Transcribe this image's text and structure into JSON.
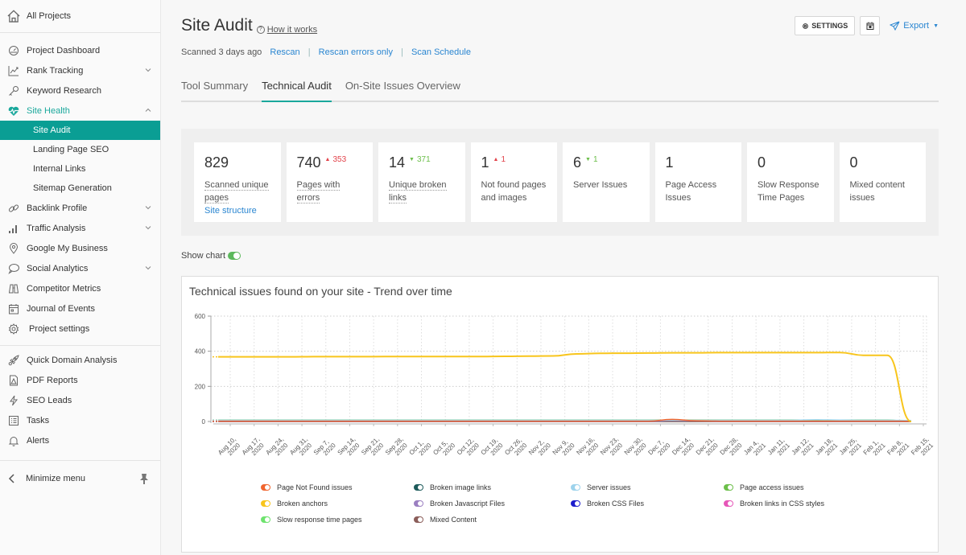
{
  "sidebar": {
    "all_projects": "All Projects",
    "items": [
      {
        "label": "Project Dashboard",
        "icon": "gauge-icon",
        "chevron": null
      },
      {
        "label": "Rank Tracking",
        "icon": "chart-line-icon",
        "chevron": "down"
      },
      {
        "label": "Keyword Research",
        "icon": "key-icon",
        "chevron": null
      },
      {
        "label": "Site Health",
        "icon": "heart-pulse-icon",
        "chevron": "up"
      }
    ],
    "site_health_sub": [
      "Site Audit",
      "Landing Page SEO",
      "Internal Links",
      "Sitemap Generation"
    ],
    "items_after": [
      {
        "label": "Backlink Profile",
        "icon": "link-icon",
        "chevron": "down"
      },
      {
        "label": "Traffic Analysis",
        "icon": "bar-chart-icon",
        "chevron": "down"
      },
      {
        "label": "Google My Business",
        "icon": "map-pin-icon",
        "chevron": null
      },
      {
        "label": "Social Analytics",
        "icon": "speech-bubble-icon",
        "chevron": "down"
      },
      {
        "label": "Competitor Metrics",
        "icon": "binoculars-icon",
        "chevron": null
      },
      {
        "label": "Journal of Events",
        "icon": "calendar-icon",
        "chevron": null
      },
      {
        "label": "Project settings",
        "icon": "gear-icon",
        "chevron": null
      }
    ],
    "tools": [
      {
        "label": "Quick Domain Analysis",
        "icon": "rocket-icon"
      },
      {
        "label": "PDF Reports",
        "icon": "pdf-icon"
      },
      {
        "label": "SEO Leads",
        "icon": "lightning-icon"
      },
      {
        "label": "Tasks",
        "icon": "list-icon"
      },
      {
        "label": "Alerts",
        "icon": "bell-icon"
      }
    ],
    "minimize": "Minimize menu"
  },
  "header": {
    "title": "Site Audit",
    "how_it_works": "How it works",
    "scanned": "Scanned 3 days ago",
    "rescan": "Rescan",
    "rescan_errors": "Rescan errors only",
    "scan_schedule": "Scan Schedule",
    "settings_label": "SETTINGS",
    "export_label": "Export"
  },
  "tabs": [
    {
      "label": "Tool Summary",
      "active": false
    },
    {
      "label": "Technical Audit",
      "active": true
    },
    {
      "label": "On-Site Issues Overview",
      "active": false
    }
  ],
  "stats": [
    {
      "value": "829",
      "delta": null,
      "dir": null,
      "label": "Scanned unique pages",
      "dotted": true,
      "link": "Site structure"
    },
    {
      "value": "740",
      "delta": "353",
      "dir": "up",
      "label": "Pages with errors",
      "dotted": true,
      "link": null
    },
    {
      "value": "14",
      "delta": "371",
      "dir": "down",
      "label": "Unique broken links",
      "dotted": true,
      "link": null
    },
    {
      "value": "1",
      "delta": "1",
      "dir": "up",
      "label": "Not found pages and images",
      "dotted": false,
      "link": null
    },
    {
      "value": "6",
      "delta": "1",
      "dir": "down",
      "label": "Server Issues",
      "dotted": false,
      "link": null
    },
    {
      "value": "1",
      "delta": null,
      "dir": null,
      "label": "Page Access Issues",
      "dotted": false,
      "link": null
    },
    {
      "value": "0",
      "delta": null,
      "dir": null,
      "label": "Slow Response Time Pages",
      "dotted": false,
      "link": null
    },
    {
      "value": "0",
      "delta": null,
      "dir": null,
      "label": "Mixed content issues",
      "dotted": false,
      "link": null
    }
  ],
  "show_chart_label": "Show chart",
  "chart_data": {
    "type": "line",
    "title": "Technical issues found on your site - Trend over time",
    "xlabel": "",
    "ylabel": "",
    "ylim": [
      0,
      600
    ],
    "yticks": [
      0,
      200,
      400,
      600
    ],
    "grid": true,
    "legend_position": "bottom",
    "x": [
      "Aug 10, 2020",
      "Aug 17, 2020",
      "Aug 24, 2020",
      "Aug 31, 2020",
      "Sep 7, 2020",
      "Sep 14, 2020",
      "Sep 21, 2020",
      "Sep 28, 2020",
      "Oct 1, 2020",
      "Oct 5, 2020",
      "Oct 12, 2020",
      "Oct 19, 2020",
      "Oct 26, 2020",
      "Nov 2, 2020",
      "Nov 9, 2020",
      "Nov 16, 2020",
      "Nov 23, 2020",
      "Nov 30, 2020",
      "Dec 7, 2020",
      "Dec 14, 2020",
      "Dec 21, 2020",
      "Dec 28, 2020",
      "Jan 4, 2021",
      "Jan 11, 2021",
      "Jan 12, 2021",
      "Jan 18, 2021",
      "Jan 25, 2021",
      "Feb 1, 2021",
      "Feb 8, 2021",
      "Feb 15, 2021"
    ],
    "series": [
      {
        "name": "Page Not Found issues",
        "color": "#f0652f",
        "values": [
          2,
          2,
          2,
          2,
          2,
          2,
          2,
          2,
          2,
          2,
          2,
          2,
          2,
          2,
          2,
          2,
          2,
          2,
          2,
          12,
          4,
          2,
          2,
          2,
          2,
          2,
          2,
          2,
          2,
          1
        ]
      },
      {
        "name": "Broken image links",
        "color": "#1e5b5b",
        "values": [
          0,
          0,
          0,
          0,
          0,
          0,
          0,
          0,
          0,
          0,
          0,
          0,
          0,
          0,
          0,
          0,
          0,
          0,
          0,
          0,
          0,
          0,
          0,
          0,
          0,
          0,
          0,
          0,
          0,
          0
        ]
      },
      {
        "name": "Server issues",
        "color": "#9ed3ec",
        "values": [
          7,
          7,
          7,
          7,
          7,
          7,
          7,
          7,
          7,
          7,
          7,
          7,
          7,
          7,
          7,
          7,
          7,
          7,
          7,
          7,
          7,
          7,
          7,
          7,
          7,
          10,
          8,
          7,
          7,
          6
        ]
      },
      {
        "name": "Page access issues",
        "color": "#6cbf4a",
        "values": [
          8,
          8,
          8,
          8,
          8,
          8,
          8,
          8,
          8,
          8,
          8,
          8,
          8,
          8,
          8,
          8,
          8,
          8,
          8,
          8,
          8,
          8,
          8,
          8,
          8,
          8,
          8,
          8,
          8,
          1
        ]
      },
      {
        "name": "Broken anchors",
        "color": "#f8c51c",
        "values": [
          368,
          368,
          368,
          368,
          369,
          369,
          369,
          370,
          370,
          370,
          370,
          370,
          371,
          372,
          373,
          385,
          388,
          389,
          390,
          391,
          391,
          392,
          392,
          392,
          392,
          392,
          393,
          377,
          377,
          0
        ]
      },
      {
        "name": "Broken Javascript Files",
        "color": "#9b7fc1",
        "values": [
          0,
          0,
          0,
          0,
          0,
          0,
          0,
          0,
          0,
          0,
          0,
          0,
          0,
          0,
          0,
          0,
          0,
          0,
          0,
          5,
          3,
          0,
          0,
          0,
          0,
          0,
          0,
          0,
          0,
          0
        ]
      },
      {
        "name": "Broken CSS Files",
        "color": "#1c1ccc",
        "values": [
          0,
          0,
          0,
          0,
          0,
          0,
          0,
          0,
          0,
          0,
          0,
          0,
          0,
          0,
          0,
          0,
          0,
          0,
          0,
          0,
          0,
          0,
          0,
          0,
          0,
          0,
          0,
          0,
          0,
          0
        ]
      },
      {
        "name": "Broken links in CSS styles",
        "color": "#e657b8",
        "values": [
          0,
          0,
          0,
          0,
          0,
          0,
          0,
          0,
          0,
          0,
          0,
          0,
          0,
          0,
          0,
          0,
          0,
          0,
          0,
          0,
          0,
          0,
          0,
          0,
          0,
          0,
          0,
          0,
          0,
          0
        ]
      },
      {
        "name": "Slow response time pages",
        "color": "#6ee36e",
        "values": [
          0,
          0,
          0,
          0,
          0,
          0,
          0,
          0,
          0,
          0,
          0,
          0,
          0,
          0,
          0,
          0,
          0,
          0,
          0,
          0,
          0,
          0,
          0,
          0,
          0,
          0,
          0,
          0,
          0,
          0
        ]
      },
      {
        "name": "Mixed Content",
        "color": "#8b5e5a",
        "values": [
          0,
          0,
          0,
          0,
          0,
          0,
          0,
          0,
          0,
          0,
          0,
          0,
          0,
          0,
          0,
          0,
          0,
          0,
          0,
          0,
          0,
          0,
          0,
          0,
          0,
          0,
          0,
          0,
          0,
          0
        ]
      }
    ],
    "legend_order": [
      "Page Not Found issues",
      "Broken image links",
      "Server issues",
      "Page access issues",
      "Broken anchors",
      "Broken Javascript Files",
      "Broken CSS Files",
      "Broken links in CSS styles",
      "Slow response time pages",
      "Mixed Content"
    ]
  }
}
